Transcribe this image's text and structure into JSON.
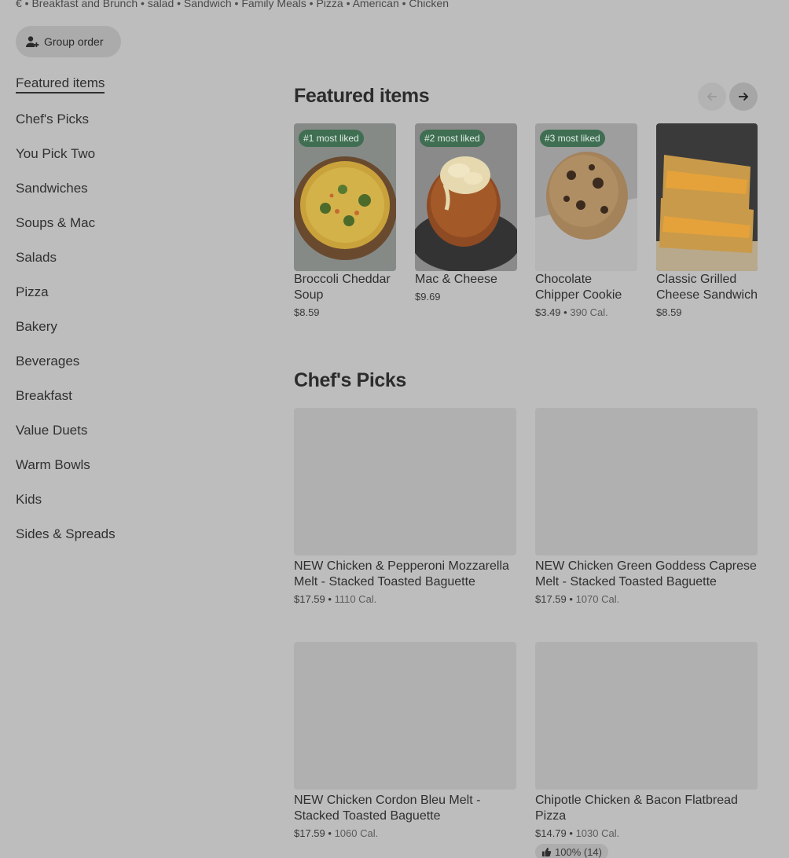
{
  "header": {
    "tags": "€ • Breakfast and Brunch • salad • Sandwich • Family Meals • Pizza • American • Chicken",
    "group_order_label": "Group order"
  },
  "sidebar": {
    "items": [
      {
        "label": "Featured items"
      },
      {
        "label": "Chef's Picks"
      },
      {
        "label": "You Pick Two"
      },
      {
        "label": "Sandwiches"
      },
      {
        "label": "Soups & Mac"
      },
      {
        "label": "Salads"
      },
      {
        "label": "Pizza"
      },
      {
        "label": "Bakery"
      },
      {
        "label": "Beverages"
      },
      {
        "label": "Breakfast"
      },
      {
        "label": "Value Duets"
      },
      {
        "label": "Warm Bowls"
      },
      {
        "label": "Kids"
      },
      {
        "label": "Sides & Spreads"
      }
    ]
  },
  "featured": {
    "title": "Featured items",
    "items": [
      {
        "badge": "#1 most liked",
        "name": "Broccoli Cheddar Soup",
        "price": "$8.59",
        "cal": "",
        "image": "soup-bowl"
      },
      {
        "badge": "#2 most liked",
        "name": "Mac & Cheese",
        "price": "$9.69",
        "cal": "",
        "image": "bread-bowl"
      },
      {
        "badge": "#3 most liked",
        "name": "Chocolate Chipper Cookie",
        "price": "$3.49",
        "cal": "390 Cal.",
        "image": "cookie"
      },
      {
        "badge": "",
        "name": "Classic Grilled Cheese Sandwich",
        "price": "$8.59",
        "cal": "",
        "image": "grilled-cheese"
      }
    ]
  },
  "chefs_picks": {
    "title": "Chef's Picks",
    "items": [
      {
        "name": "NEW Chicken & Pepperoni Mozzarella Melt - Stacked Toasted Baguette",
        "price": "$17.59",
        "cal": "1110 Cal."
      },
      {
        "name": "NEW Chicken Green Goddess Caprese Melt - Stacked Toasted Baguette",
        "price": "$17.59",
        "cal": "1070 Cal."
      },
      {
        "name": "NEW Chicken Cordon Bleu Melt - Stacked Toasted Baguette",
        "price": "$17.59",
        "cal": "1060 Cal."
      },
      {
        "name": "Chipotle Chicken & Bacon Flatbread Pizza",
        "price": "$14.79",
        "cal": "1030 Cal.",
        "rating": "100% (14)"
      }
    ]
  },
  "sep": "•"
}
